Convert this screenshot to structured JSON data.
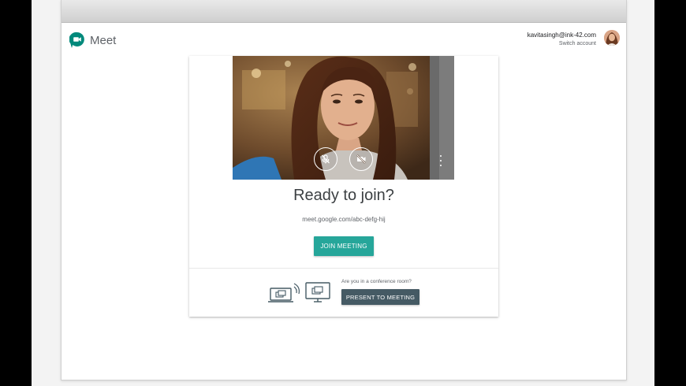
{
  "app": {
    "name": "Meet"
  },
  "account": {
    "email": "kavitasingh@ink-42.com",
    "switch_label": "Switch account"
  },
  "video": {
    "mic_icon": "mic-off-icon",
    "camera_icon": "videocam-off-icon",
    "more_icon": "more-vert-icon"
  },
  "join": {
    "heading": "Ready to join?",
    "meeting_url": "meet.google.com/abc-defg-hij",
    "join_button": "JOIN MEETING"
  },
  "conference": {
    "question": "Are you in a conference room?",
    "present_button": "PRESENT TO MEETING"
  },
  "colors": {
    "join_button": "#26a69a",
    "present_button": "#455a64",
    "logo_green": "#00897b"
  }
}
